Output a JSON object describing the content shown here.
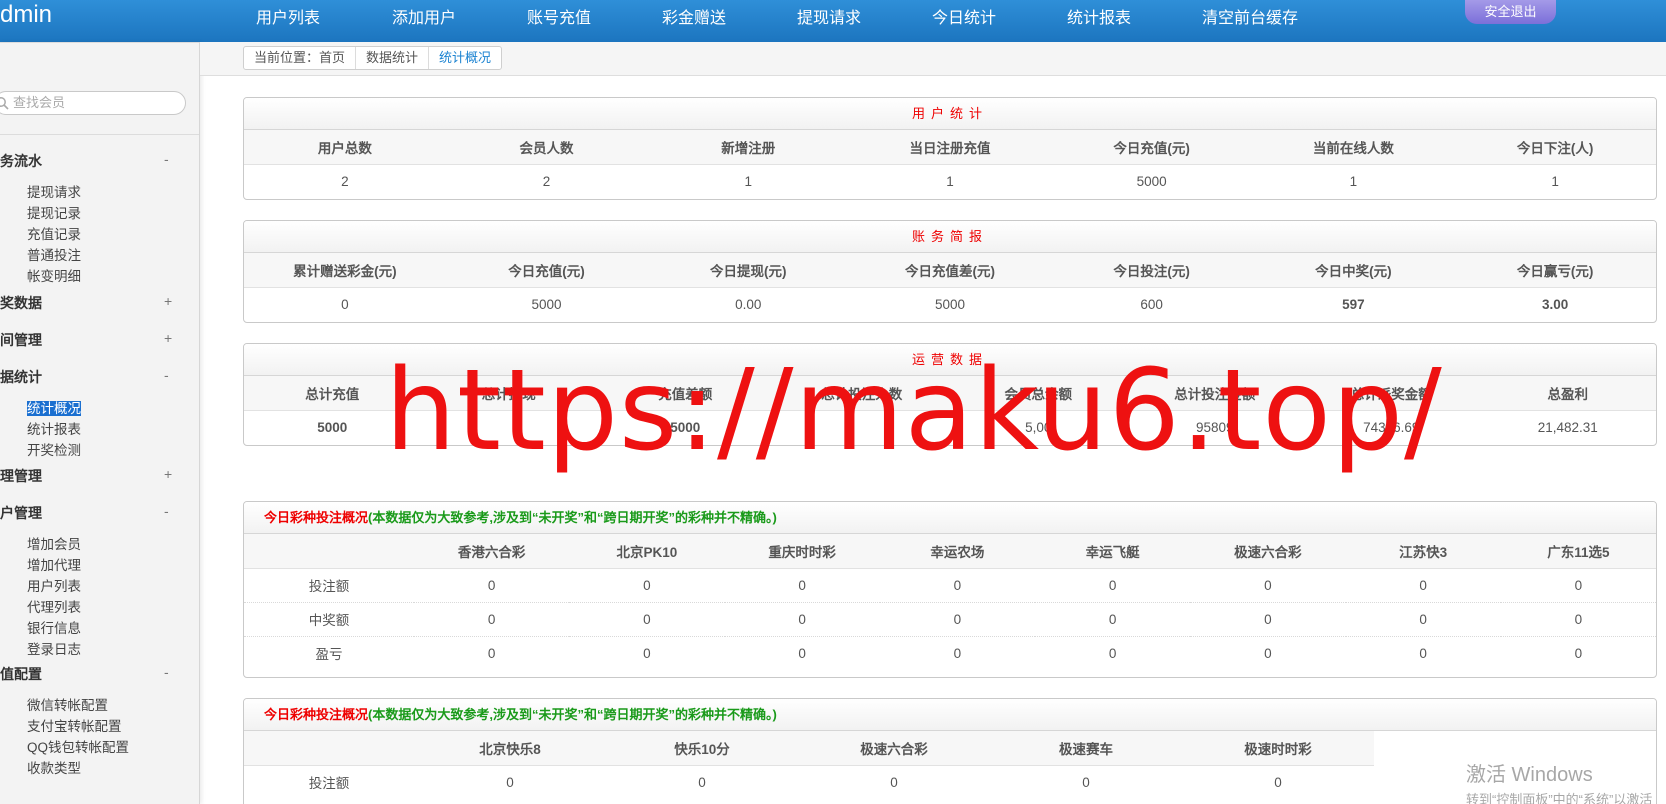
{
  "header": {
    "brand": "dmin",
    "nav": [
      "用户列表",
      "添加用户",
      "账号充值",
      "彩金赠送",
      "提现请求",
      "今日统计",
      "统计报表",
      "清空前台缓存"
    ],
    "logout": "安全退出",
    "accent": "#1c75bf"
  },
  "sidebar": {
    "search_placeholder": "查找会员",
    "groups": [
      {
        "label": "业务流水",
        "toggle": "-",
        "items": [
          "提现请求",
          "提现记录",
          "充值记录",
          "普通投注",
          "帐变明细"
        ]
      },
      {
        "label": "开奖数据",
        "toggle": "+",
        "items": []
      },
      {
        "label": "时间管理",
        "toggle": "+",
        "items": []
      },
      {
        "label": "数据统计",
        "toggle": "-",
        "items": [
          "统计概况",
          "统计报表",
          "开奖检测"
        ]
      },
      {
        "label": "代理管理",
        "toggle": "+",
        "items": []
      },
      {
        "label": "用户管理",
        "toggle": "-",
        "items": [
          "增加会员",
          "增加代理",
          "用户列表",
          "代理列表",
          "银行信息",
          "登录日志"
        ]
      },
      {
        "label": "充值配置",
        "toggle": "-",
        "items": [
          "微信转帐配置",
          "支付宝转帐配置",
          "QQ钱包转帐配置",
          "收款类型"
        ]
      }
    ]
  },
  "breadcrumb": [
    "当前位置：首页",
    "数据统计",
    "统计概况"
  ],
  "user_stats": {
    "title": "用户统计",
    "headers": [
      "用户总数",
      "会员人数",
      "新增注册",
      "当日注册充值",
      "今日充值(元)",
      "当前在线人数",
      "今日下注(人)"
    ],
    "values": [
      "2",
      "2",
      "1",
      "1",
      "5000",
      "1",
      "1"
    ]
  },
  "finance": {
    "title": "账务简报",
    "headers": [
      "累计赠送彩金(元)",
      "今日充值(元)",
      "今日提现(元)",
      "今日充值差(元)",
      "今日投注(元)",
      "今日中奖(元)",
      "今日赢亏(元)"
    ],
    "values": [
      "0",
      "5000",
      "0.00",
      "5000",
      "600",
      "597",
      "3.00"
    ]
  },
  "operations": {
    "title": "运营数据",
    "headers": [
      "总计充值",
      "总计提现",
      "充值差额",
      "总计投注人数",
      "会员总余额",
      "总计投注金额",
      "总计派奖金额",
      "总盈利"
    ],
    "values": [
      "5000",
      "",
      "5000",
      "",
      "5,00",
      "95809",
      "74326.69",
      "21,482.31"
    ]
  },
  "lottery1": {
    "title_red": "今日彩种投注概况",
    "title_green": "(本数据仅为大致参考,涉及到“未开奖”和“跨日期开奖”的彩种并不精确。)",
    "headers": [
      "",
      "香港六合彩",
      "北京PK10",
      "重庆时时彩",
      "幸运农场",
      "幸运飞艇",
      "极速六合彩",
      "江苏快3",
      "广东11选5"
    ],
    "rows": [
      {
        "label": "投注额",
        "values": [
          "0",
          "0",
          "0",
          "0",
          "0",
          "0",
          "0",
          "0"
        ]
      },
      {
        "label": "中奖额",
        "values": [
          "0",
          "0",
          "0",
          "0",
          "0",
          "0",
          "0",
          "0"
        ]
      },
      {
        "label": "盈亏",
        "values": [
          "0",
          "0",
          "0",
          "0",
          "0",
          "0",
          "0",
          "0"
        ]
      }
    ]
  },
  "lottery2": {
    "title_red": "今日彩种投注概况",
    "title_green": "(本数据仅为大致参考,涉及到“未开奖”和“跨日期开奖”的彩种并不精确。)",
    "headers": [
      "",
      "北京快乐8",
      "快乐10分",
      "极速六合彩",
      "极速赛车",
      "极速时时彩"
    ],
    "rows": [
      {
        "label": "投注额",
        "values": [
          "0",
          "0",
          "0",
          "0",
          "0"
        ]
      }
    ]
  },
  "watermark": "https://maku6.top/",
  "windows": {
    "line1": "激活 Windows",
    "line2": "转到“控制面板”中的“系统”以激活"
  }
}
